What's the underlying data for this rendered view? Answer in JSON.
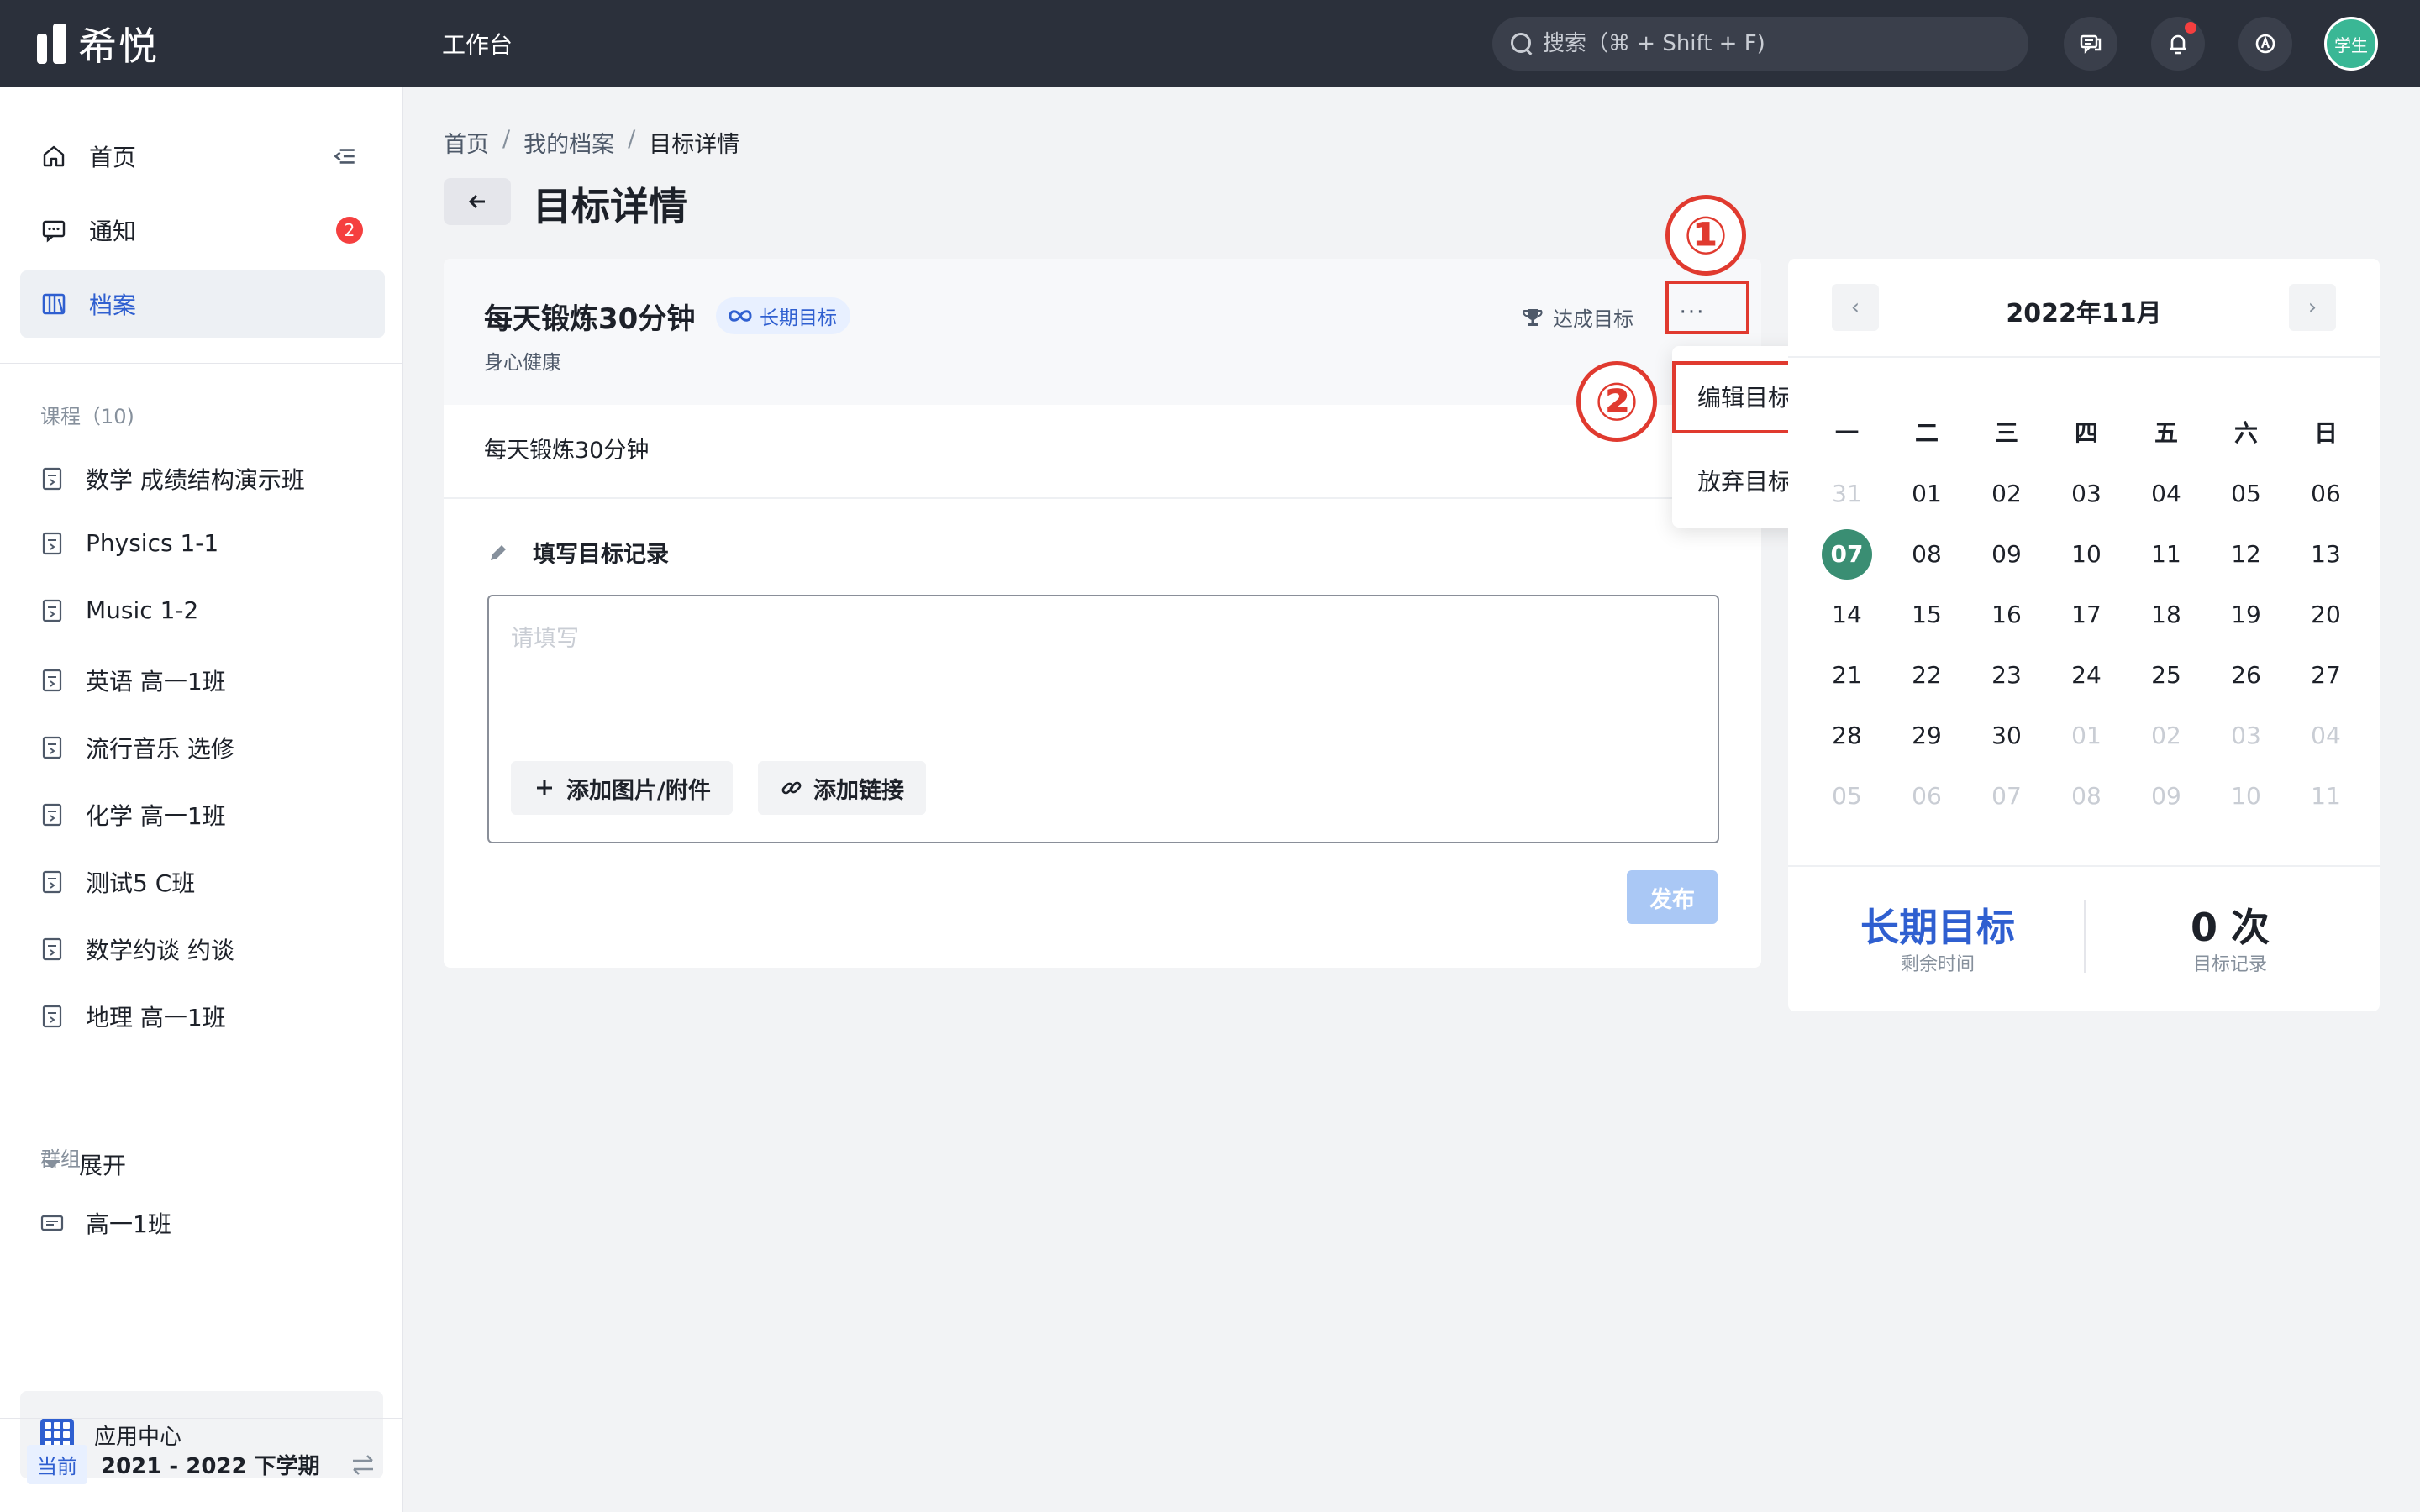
{
  "app": {
    "logo_text": "希悦",
    "workbench": "工作台",
    "search_placeholder": "搜索（⌘ + Shift + F)",
    "avatar_label": "学生"
  },
  "colors": {
    "topbar": "#2b303b",
    "accent": "#2f5fd0",
    "today": "#3a8e73",
    "annotation": "#e03a2f",
    "badge": "#f53f3f"
  },
  "sidebar": {
    "nav": [
      {
        "label": "首页",
        "icon": "home-icon"
      },
      {
        "label": "通知",
        "icon": "message-icon",
        "badge": "2"
      },
      {
        "label": "档案",
        "icon": "archive-icon",
        "active": true
      }
    ],
    "courses_title": "课程（10)",
    "courses": [
      "数学 成绩结构演示班",
      "Physics 1-1",
      "Music 1-2",
      "英语 高一1班",
      "流行音乐 选修",
      "化学 高一1班",
      "测试5 C班",
      "数学约谈 约谈",
      "地理 高一1班"
    ],
    "expand_label": "展开",
    "groups_title": "群组",
    "groups": [
      "高一1班"
    ],
    "app_center": "应用中心",
    "term_tag": "当前",
    "term": "2021 - 2022 下学期"
  },
  "breadcrumb": [
    "首页",
    "我的档案",
    "目标详情"
  ],
  "page_title": "目标详情",
  "goal": {
    "title": "每天锻炼30分钟",
    "tag": "长期目标",
    "category": "身心健康",
    "achieve_label": "达成目标",
    "more_label": "···",
    "description": "每天锻炼30分钟",
    "record_title": "填写目标记录",
    "editor_placeholder": "请填写",
    "add_attachment": "添加图片/附件",
    "add_link": "添加链接",
    "publish": "发布"
  },
  "dropdown": [
    "编辑目标",
    "放弃目标"
  ],
  "annotations": [
    "①",
    "②"
  ],
  "calendar": {
    "month": "2022年11月",
    "prev": "‹",
    "next": "›",
    "weekdays": [
      "一",
      "二",
      "三",
      "四",
      "五",
      "六",
      "日"
    ],
    "weeks": [
      [
        "31",
        "01",
        "02",
        "03",
        "04",
        "05",
        "06"
      ],
      [
        "07",
        "08",
        "09",
        "10",
        "11",
        "12",
        "13"
      ],
      [
        "14",
        "15",
        "16",
        "17",
        "18",
        "19",
        "20"
      ],
      [
        "21",
        "22",
        "23",
        "24",
        "25",
        "26",
        "27"
      ],
      [
        "28",
        "29",
        "30",
        "01",
        "02",
        "03",
        "04"
      ],
      [
        "05",
        "06",
        "07",
        "08",
        "09",
        "10",
        "11"
      ]
    ],
    "today": "07",
    "stat_left_value": "长期目标",
    "stat_left_label": "剩余时间",
    "stat_right_value": "0 次",
    "stat_right_label": "目标记录"
  }
}
